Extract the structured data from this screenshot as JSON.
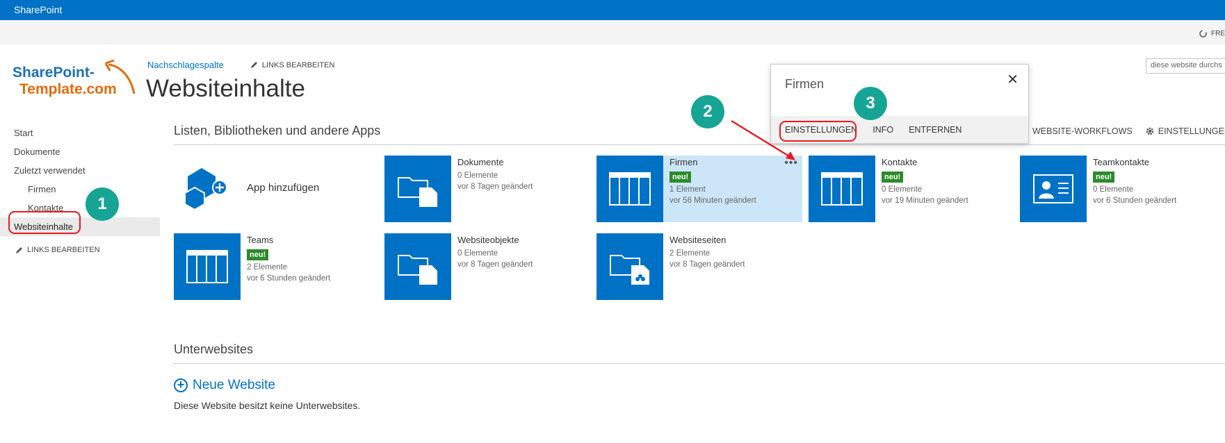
{
  "suitebar": {
    "brand": "SharePoint"
  },
  "ribbon": {
    "share_label": "FRE"
  },
  "logo": {
    "line1": "SharePoint-",
    "line2": "Template.com"
  },
  "breadcrumb": {
    "link": "Nachschlagespalte",
    "edit_links": "LINKS BEARBEITEN"
  },
  "page_title": "Websiteinhalte",
  "search": {
    "placeholder": "diese website durchs"
  },
  "nav": {
    "items": [
      {
        "label": "Start"
      },
      {
        "label": "Dokumente"
      },
      {
        "label": "Zuletzt verwendet"
      },
      {
        "label": "Firmen"
      },
      {
        "label": "Kontakte"
      },
      {
        "label": "Websiteinhalte"
      }
    ],
    "edit_links": "LINKS BEARBEITEN"
  },
  "sections": {
    "lists_title": "Listen, Bibliotheken und andere Apps",
    "subsites_title": "Unterwebsites"
  },
  "toolbar": {
    "workflows": "WEBSITE-WORKFLOWS",
    "settings": "EINSTELLUNGEN"
  },
  "add_app": {
    "label": "App hinzufügen"
  },
  "tiles": [
    {
      "name": "Dokumente",
      "badge": "",
      "count": "0 Elemente",
      "changed": "vor 8 Tagen geändert",
      "icon": "library-icon"
    },
    {
      "name": "Firmen",
      "badge": "neu!",
      "count": "1 Element",
      "changed": "vor 56 Minuten geändert",
      "icon": "list-icon",
      "dots": "•••"
    },
    {
      "name": "Kontakte",
      "badge": "neu!",
      "count": "0 Elemente",
      "changed": "vor 19 Minuten geändert",
      "icon": "list-icon"
    },
    {
      "name": "Teamkontakte",
      "badge": "neu!",
      "count": "0 Elemente",
      "changed": "vor 6 Stunden geändert",
      "icon": "contact-card-icon"
    },
    {
      "name": "Teams",
      "badge": "neu!",
      "count": "2 Elemente",
      "changed": "vor 6 Stunden geändert",
      "icon": "list-icon"
    },
    {
      "name": "Websiteobjekte",
      "badge": "",
      "count": "0 Elemente",
      "changed": "vor 8 Tagen geändert",
      "icon": "library-icon"
    },
    {
      "name": "Websiteseiten",
      "badge": "",
      "count": "2 Elemente",
      "changed": "vor 8 Tagen geändert",
      "icon": "site-pages-icon"
    }
  ],
  "popup": {
    "title": "Firmen",
    "close": "✕",
    "actions": {
      "settings": "EINSTELLUNGEN",
      "info": "INFO",
      "remove": "ENTFERNEN"
    }
  },
  "subsites": {
    "new_site": "Neue Website",
    "empty_text": "Diese Website besitzt keine Unterwebsites."
  },
  "annotations": {
    "step1": "1",
    "step2": "2",
    "step3": "3"
  },
  "colors": {
    "accent": "#0072c6",
    "badge": "#2c8b2c",
    "highlight": "#e8191f",
    "bubble": "#16a595"
  }
}
